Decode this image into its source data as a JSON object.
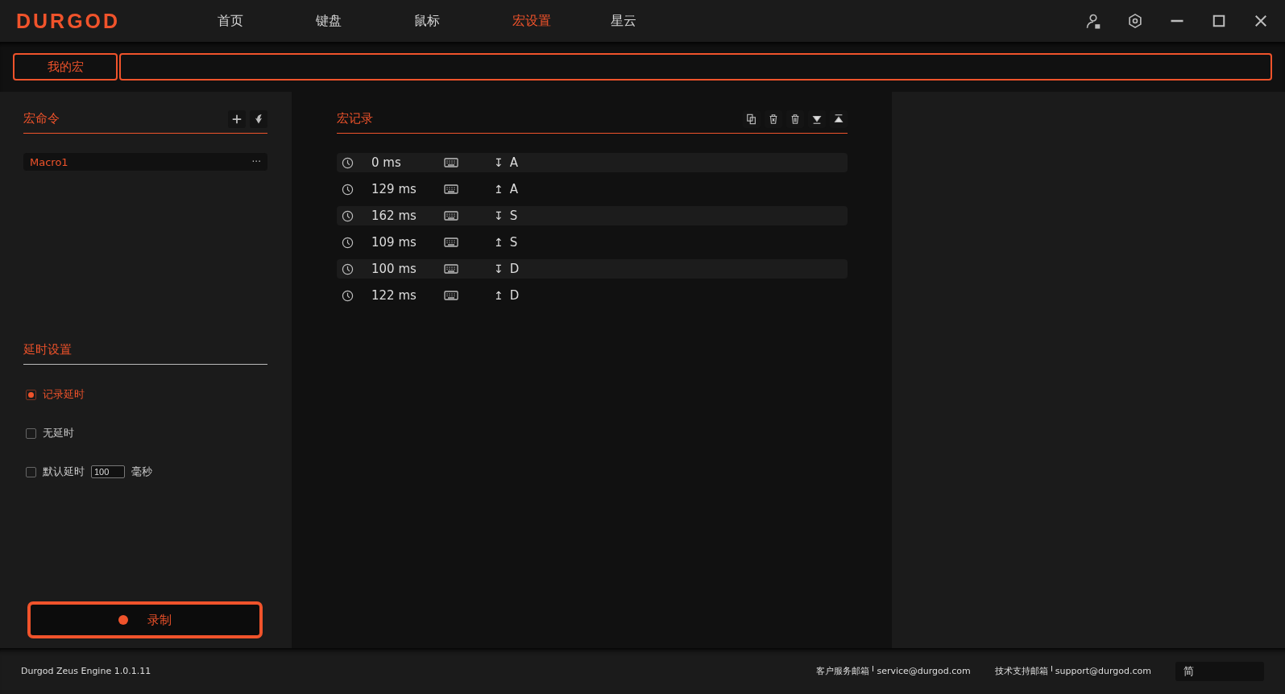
{
  "app": {
    "logo": "DURGOD"
  },
  "nav": [
    {
      "label": "首页",
      "selected": false
    },
    {
      "label": "键盘",
      "selected": false
    },
    {
      "label": "鼠标",
      "selected": false
    },
    {
      "label": "宏设置",
      "selected": true
    },
    {
      "label": "星云",
      "selected": false
    }
  ],
  "subtabs": [
    {
      "label": "我的宏",
      "selected": true
    }
  ],
  "macro_commands": {
    "title": "宏命令",
    "items": [
      {
        "name": "Macro1",
        "selected": true,
        "menu": "···"
      }
    ]
  },
  "delay_settings": {
    "title": "延时设置",
    "options": [
      {
        "kind": "plain",
        "label": "记录延时",
        "selected": true
      },
      {
        "kind": "plain",
        "label": "无延时",
        "selected": false
      },
      {
        "kind": "input",
        "label": "默认延时",
        "value": "100",
        "unit": "毫秒",
        "selected": false
      }
    ]
  },
  "record_button": {
    "label": "录制"
  },
  "macro_record": {
    "title": "宏记录",
    "events": [
      {
        "time": "0 ms",
        "arrow": "↧",
        "key": "A"
      },
      {
        "time": "129 ms",
        "arrow": "↥",
        "key": "A"
      },
      {
        "time": "162 ms",
        "arrow": "↧",
        "key": "S"
      },
      {
        "time": "109 ms",
        "arrow": "↥",
        "key": "S"
      },
      {
        "time": "100 ms",
        "arrow": "↧",
        "key": "D"
      },
      {
        "time": "122 ms",
        "arrow": "↥",
        "key": "D"
      }
    ]
  },
  "status_bar": {
    "version": "Durgod Zeus Engine 1.0.1.11",
    "contacts": [
      {
        "label": "客户服务邮箱",
        "value": "service@durgod.com"
      },
      {
        "label": "技术支持邮箱",
        "value": "support@durgod.com"
      }
    ],
    "language": "简"
  }
}
